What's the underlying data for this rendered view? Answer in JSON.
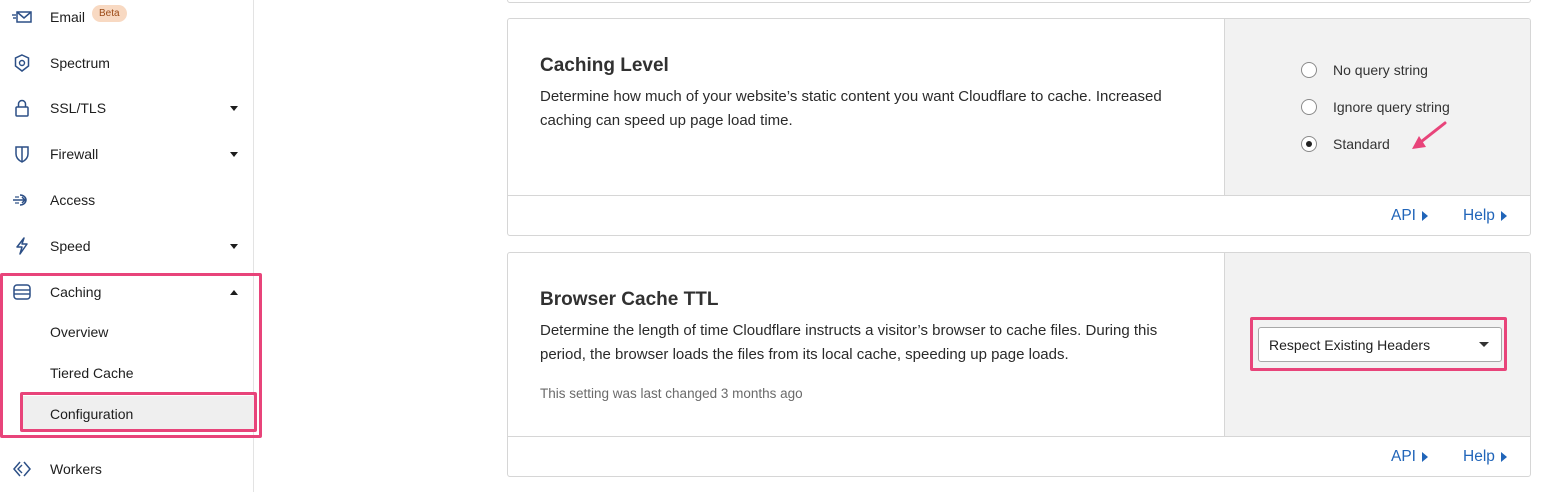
{
  "sidebar": {
    "items": [
      {
        "label": "Email",
        "icon": "email-icon",
        "badge": "Beta"
      },
      {
        "label": "Spectrum",
        "icon": "spectrum-shield-icon"
      },
      {
        "label": "SSL/TLS",
        "icon": "lock-icon"
      },
      {
        "label": "Firewall",
        "icon": "shield-icon"
      },
      {
        "label": "Access",
        "icon": "access-icon"
      },
      {
        "label": "Speed",
        "icon": "lightning-icon"
      },
      {
        "label": "Caching",
        "icon": "server-stack-icon",
        "expanded": true
      },
      {
        "label": "Workers",
        "icon": "workers-icon"
      }
    ],
    "caching_sub": [
      {
        "label": "Overview"
      },
      {
        "label": "Tiered Cache"
      },
      {
        "label": "Configuration",
        "active": true
      }
    ]
  },
  "caching_level": {
    "title": "Caching Level",
    "description": "Determine how much of your website’s static content you want Cloudflare to cache. Increased caching can speed up page load time.",
    "options": [
      {
        "label": "No query string",
        "selected": false
      },
      {
        "label": "Ignore query string",
        "selected": false
      },
      {
        "label": "Standard",
        "selected": true
      }
    ],
    "api_link": "API",
    "help_link": "Help"
  },
  "browser_cache": {
    "title": "Browser Cache TTL",
    "description": "Determine the length of time Cloudflare instructs a visitor’s browser to cache files. During this period, the browser loads the files from its local cache, speeding up page loads.",
    "note": "This setting was last changed 3 months ago",
    "select_value": "Respect Existing Headers",
    "api_link": "API",
    "help_link": "Help"
  },
  "colors": {
    "highlight": "#e8447a",
    "link": "#2165b9",
    "icon": "#2c4f86"
  }
}
